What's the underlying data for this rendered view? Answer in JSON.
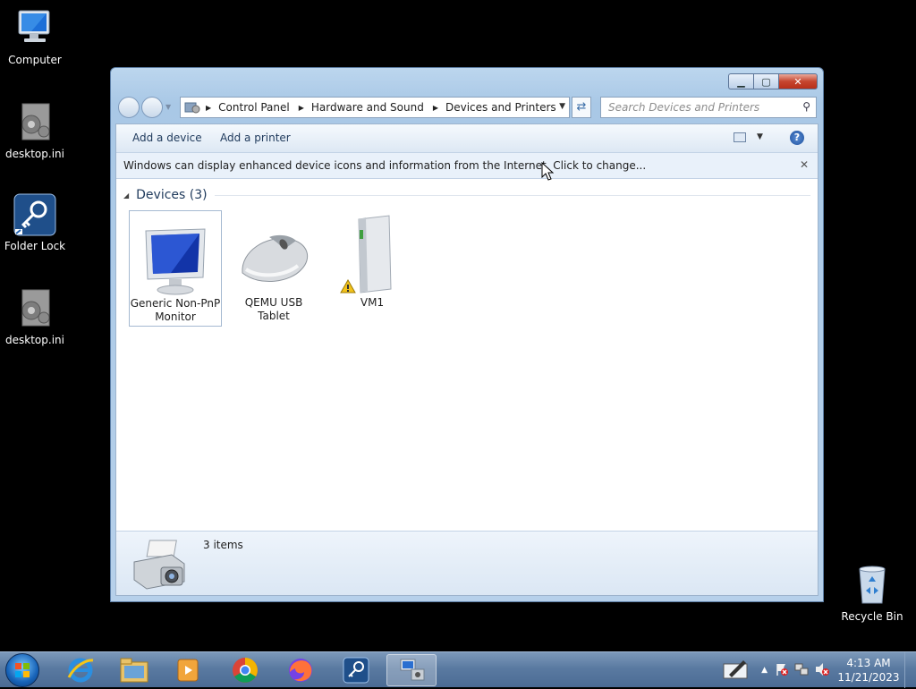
{
  "desktop": {
    "icons": [
      {
        "label": "Computer"
      },
      {
        "label": "desktop.ini"
      },
      {
        "label": "Folder Lock"
      },
      {
        "label": "desktop.ini"
      },
      {
        "label": "Recycle Bin"
      }
    ]
  },
  "window": {
    "controls": {
      "minimize": "▁",
      "maximize": "▢",
      "close": "✕"
    },
    "breadcrumb": [
      "Control Panel",
      "Hardware and Sound",
      "Devices and Printers"
    ],
    "search_placeholder": "Search Devices and Printers",
    "commands": {
      "add_device": "Add a device",
      "add_printer": "Add a printer"
    },
    "help_label": "?",
    "infobar": {
      "text": "Windows can display enhanced device icons and information from the Internet. Click to change...",
      "close": "✕"
    },
    "group": {
      "title": "Devices (3)"
    },
    "devices": [
      {
        "name_line1": "Generic Non-PnP",
        "name_line2": "Monitor",
        "selected": true
      },
      {
        "name_line1": "QEMU USB",
        "name_line2": "Tablet",
        "selected": false
      },
      {
        "name_line1": "VM1",
        "name_line2": "",
        "warning": true,
        "selected": false
      }
    ],
    "details": {
      "count": "3 items"
    }
  },
  "taskbar": {
    "apps": [
      "internet-explorer",
      "windows-explorer",
      "media-player",
      "chrome",
      "firefox",
      "folder-lock",
      "devices-and-printers"
    ],
    "clock": {
      "time": "4:13 AM",
      "date": "11/21/2023"
    }
  },
  "colors": {
    "accent": "#1e395b",
    "taskbar": "#5a7aa1",
    "titlebar": "#a9c8e6",
    "close": "#c6452f"
  }
}
